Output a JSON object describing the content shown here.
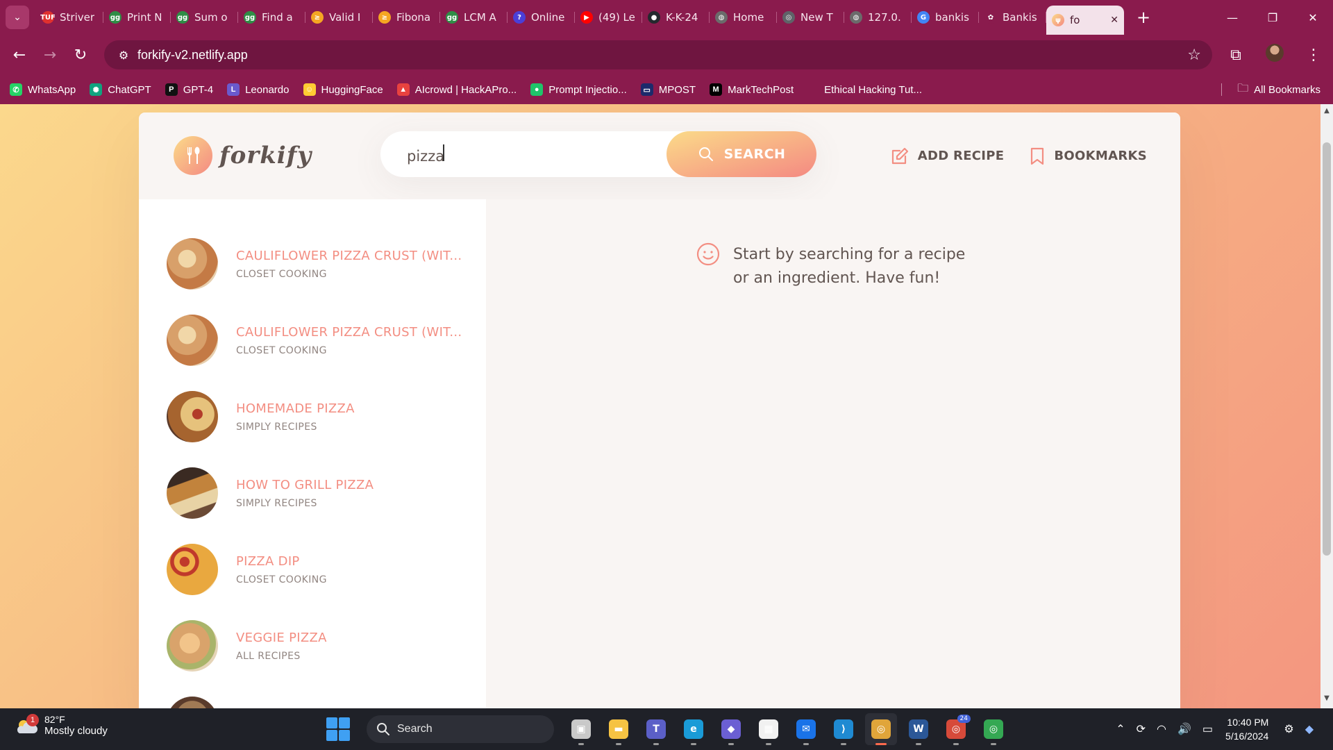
{
  "browser": {
    "tabs": [
      {
        "label": "Striver",
        "icon": "tuf-icon",
        "color": "#e0312f",
        "glyph": "TUF"
      },
      {
        "label": "Print N",
        "icon": "gfg-icon",
        "color": "#2f8d46",
        "glyph": "gg"
      },
      {
        "label": "Sum o",
        "icon": "gfg-icon",
        "color": "#2f8d46",
        "glyph": "gg"
      },
      {
        "label": "Find a",
        "icon": "gfg-icon",
        "color": "#2f8d46",
        "glyph": "gg"
      },
      {
        "label": "Valid I",
        "icon": "codechef-icon",
        "color": "#f5a623",
        "glyph": "≥"
      },
      {
        "label": "Fibona",
        "icon": "codechef-icon",
        "color": "#f5a623",
        "glyph": "≥"
      },
      {
        "label": "LCM A",
        "icon": "gfg-icon",
        "color": "#2f8d46",
        "glyph": "gg"
      },
      {
        "label": "Online",
        "icon": "compiler-icon",
        "color": "#4a3fd8",
        "glyph": "?"
      },
      {
        "label": "(49) Le",
        "icon": "youtube-icon",
        "color": "#ff0000",
        "glyph": "▶"
      },
      {
        "label": "K-K-24",
        "icon": "github-icon",
        "color": "#24292e",
        "glyph": "●"
      },
      {
        "label": "Home",
        "icon": "globe-icon",
        "color": "#6b6b6b",
        "glyph": "◍"
      },
      {
        "label": "New T",
        "icon": "chrome-icon",
        "color": "#5f6368",
        "glyph": "◎"
      },
      {
        "label": "127.0.",
        "icon": "globe-icon",
        "color": "#6b6b6b",
        "glyph": "◍"
      },
      {
        "label": "bankis",
        "icon": "google-icon",
        "color": "#4285f4",
        "glyph": "G"
      },
      {
        "label": "Bankis",
        "icon": "bank-icon",
        "color": "#8a1b4d",
        "glyph": "✿"
      }
    ],
    "active_tab": {
      "label": "fo",
      "icon": "forkify-icon",
      "close": "✕"
    },
    "new_tab": "+",
    "url": "forkify-v2.netlify.app",
    "bookmarks": [
      {
        "label": "WhatsApp",
        "icon": "whatsapp-icon",
        "color": "#25d366",
        "glyph": "✆"
      },
      {
        "label": "ChatGPT",
        "icon": "chatgpt-icon",
        "color": "#10a37f",
        "glyph": "✺"
      },
      {
        "label": "GPT-4",
        "icon": "gpt4-icon",
        "color": "#111111",
        "glyph": "P"
      },
      {
        "label": "Leonardo",
        "icon": "leonardo-icon",
        "color": "#6a5acd",
        "glyph": "L"
      },
      {
        "label": "HuggingFace",
        "icon": "huggingface-icon",
        "color": "#ffcc33",
        "glyph": "☺"
      },
      {
        "label": "AIcrowd | HackAPro...",
        "icon": "aicrowd-icon",
        "color": "#e8423f",
        "glyph": "▲"
      },
      {
        "label": "Prompt Injectio...",
        "icon": "prompt-injection-icon",
        "color": "#1fc46a",
        "glyph": "●"
      },
      {
        "label": "MPOST",
        "icon": "mpost-icon",
        "color": "#1c2a6b",
        "glyph": "▭"
      },
      {
        "label": "MarkTechPost",
        "icon": "marktechpost-icon",
        "color": "#000000",
        "glyph": "M"
      },
      {
        "label": "Ethical Hacking Tut...",
        "icon": "",
        "color": "",
        "glyph": ""
      }
    ],
    "all_bookmarks": "All Bookmarks"
  },
  "app": {
    "logo_text": "forkify",
    "search": {
      "value": "pizza",
      "button_label": "SEARCH"
    },
    "nav": {
      "add_recipe": "ADD RECIPE",
      "bookmarks": "BOOKMARKS"
    },
    "results": [
      {
        "title": "CAULIFLOWER PIZZA CRUST (WIT...",
        "publisher": "CLOSET COOKING",
        "thumb": "pizza-crust"
      },
      {
        "title": "CAULIFLOWER PIZZA CRUST (WIT...",
        "publisher": "CLOSET COOKING",
        "thumb": "pizza-crust"
      },
      {
        "title": "HOMEMADE PIZZA",
        "publisher": "SIMPLY RECIPES",
        "thumb": "pizza-slice"
      },
      {
        "title": "HOW TO GRILL PIZZA",
        "publisher": "SIMPLY RECIPES",
        "thumb": "grilled-pizza"
      },
      {
        "title": "PIZZA DIP",
        "publisher": "CLOSET COOKING",
        "thumb": "pepperoni"
      },
      {
        "title": "VEGGIE PIZZA",
        "publisher": "ALL RECIPES",
        "thumb": "veggie"
      }
    ],
    "message": "Start by searching for a recipe or an ingredient. Have fun!",
    "colors": {
      "primary": "#f38e82",
      "gradient_start": "#fbdb89",
      "gradient_end": "#f48982",
      "text": "#615551"
    }
  },
  "taskbar": {
    "weather_temp": "82°F",
    "weather_desc": "Mostly cloudy",
    "weather_badge": "1",
    "search_label": "Search",
    "apps": [
      {
        "name": "task-view-icon",
        "color": "#c9c9c9",
        "glyph": "▣"
      },
      {
        "name": "file-explorer-icon",
        "color": "#f6c343",
        "glyph": "▬"
      },
      {
        "name": "teams-icon",
        "color": "#5b5fc7",
        "glyph": "T"
      },
      {
        "name": "edge-icon",
        "color": "#1a9bd7",
        "glyph": "e"
      },
      {
        "name": "copilot-icon",
        "color": "#6b5fd3",
        "glyph": "◆"
      },
      {
        "name": "store-icon",
        "color": "#f1f1f1",
        "glyph": "▦"
      },
      {
        "name": "mail-icon",
        "color": "#1a73e8",
        "glyph": "✉"
      },
      {
        "name": "vscode-icon",
        "color": "#1f8ad2",
        "glyph": "⟩"
      },
      {
        "name": "chrome-icon",
        "color": "#e0a53a",
        "glyph": "◎"
      },
      {
        "name": "word-icon",
        "color": "#2b5797",
        "glyph": "W"
      },
      {
        "name": "chrome-profile-icon",
        "color": "#d64a3a",
        "glyph": "◎",
        "badge": "24"
      },
      {
        "name": "chrome-profile-2-icon",
        "color": "#34a853",
        "glyph": "◎"
      }
    ],
    "time": "10:40 PM",
    "date": "5/16/2024"
  }
}
